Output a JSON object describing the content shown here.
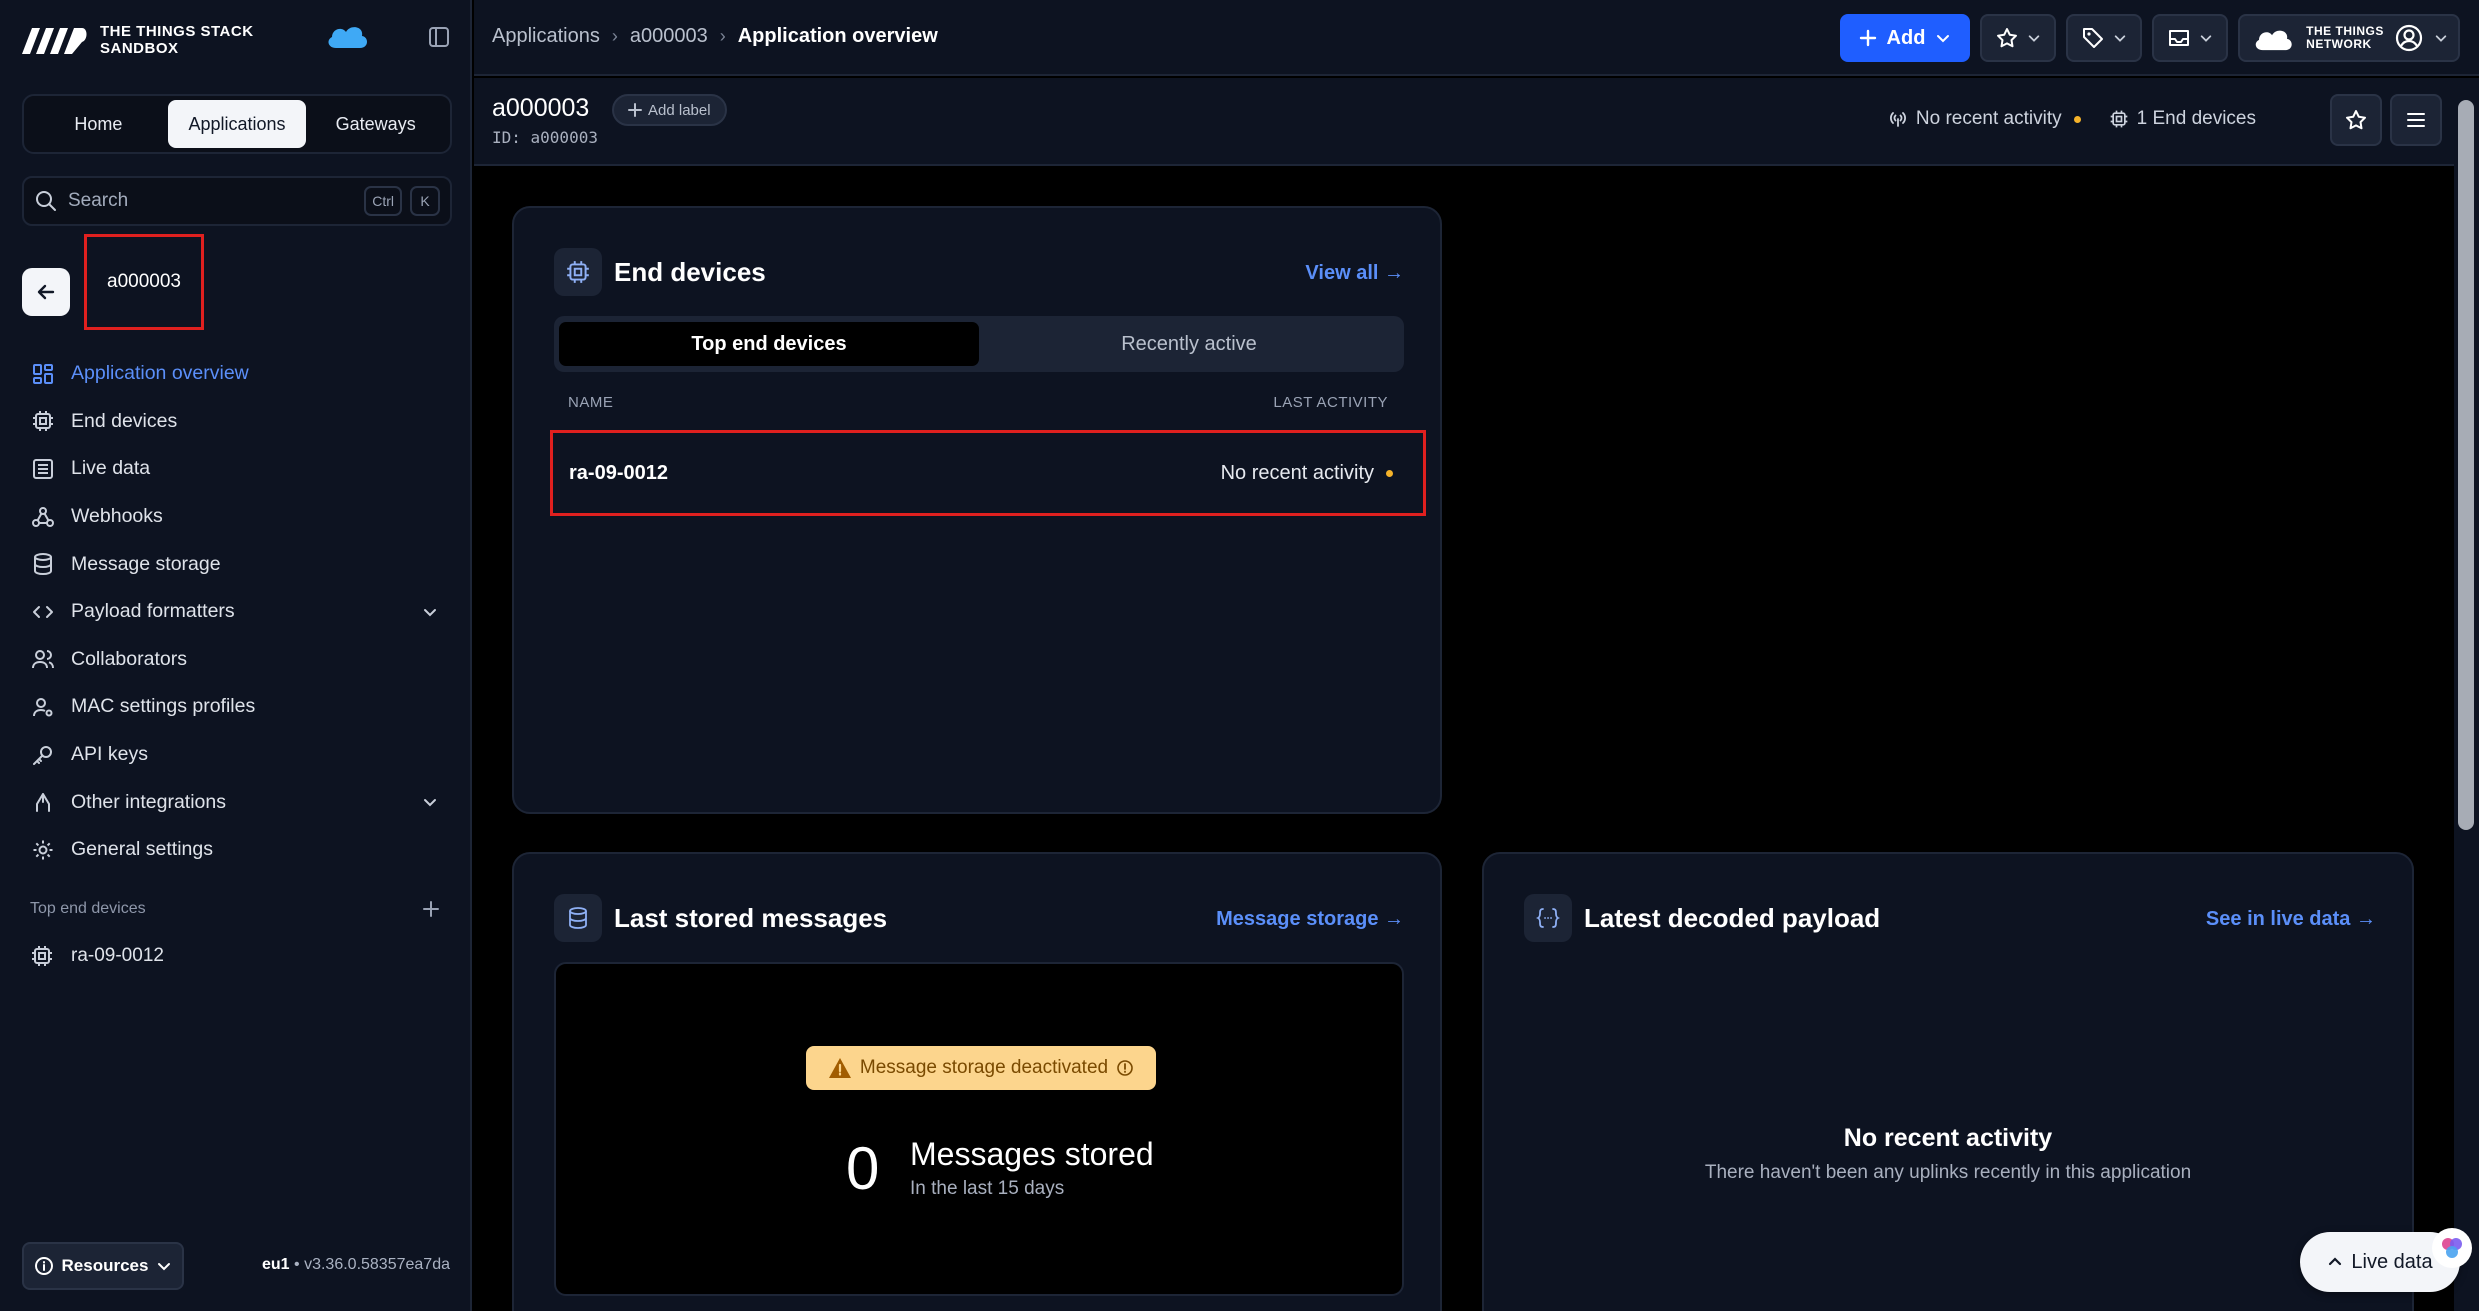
{
  "brand": {
    "logo_line1": "THE THINGS STACK",
    "logo_line2": "SANDBOX",
    "ttn_line1": "THE THINGS",
    "ttn_line2": "NETWORK"
  },
  "sidebar": {
    "segments": [
      "Home",
      "Applications",
      "Gateways"
    ],
    "active_segment": "Applications",
    "search_placeholder": "Search",
    "search_kbd": [
      "Ctrl",
      "K"
    ],
    "app_name": "a000003",
    "nav": [
      {
        "label": "Application overview",
        "icon": "grid-icon",
        "active": true
      },
      {
        "label": "End devices",
        "icon": "chip-icon"
      },
      {
        "label": "Live data",
        "icon": "list-icon"
      },
      {
        "label": "Webhooks",
        "icon": "webhook-icon"
      },
      {
        "label": "Message storage",
        "icon": "database-icon"
      },
      {
        "label": "Payload formatters",
        "icon": "code-icon",
        "expandable": true
      },
      {
        "label": "Collaborators",
        "icon": "users-icon"
      },
      {
        "label": "MAC settings profiles",
        "icon": "user-settings-icon"
      },
      {
        "label": "API keys",
        "icon": "key-icon"
      },
      {
        "label": "Other integrations",
        "icon": "integrations-icon",
        "expandable": true
      },
      {
        "label": "General settings",
        "icon": "gear-icon"
      }
    ],
    "top_devices_heading": "Top end devices",
    "top_devices": [
      "ra-09-0012"
    ],
    "resources_label": "Resources",
    "region": "eu1",
    "version": "v3.36.0.58357ea7da"
  },
  "topbar": {
    "breadcrumb": [
      "Applications",
      "a000003",
      "Application overview"
    ],
    "add_label": "Add"
  },
  "subheader": {
    "title": "a000003",
    "id_text": "ID: a000003",
    "add_label": "Add label",
    "activity": "No recent activity",
    "end_devices": "1 End devices"
  },
  "end_devices_card": {
    "title": "End devices",
    "link": "View all →",
    "tabs": [
      "Top end devices",
      "Recently active"
    ],
    "col_name": "NAME",
    "col_activity": "LAST ACTIVITY",
    "rows": [
      {
        "name": "ra-09-0012",
        "activity": "No recent activity"
      }
    ]
  },
  "messages_card": {
    "title": "Last stored messages",
    "link": "Message storage →",
    "warning": "Message storage deactivated",
    "count": "0",
    "count_label": "Messages stored",
    "count_sub": "In the last 15 days"
  },
  "payload_card": {
    "title": "Latest decoded payload",
    "link": "See in live data →",
    "empty_title": "No recent activity",
    "empty_sub": "There haven't been any uplinks recently in this application"
  },
  "floating": {
    "live_data": "Live data"
  },
  "colors": {
    "accent": "#5b8ff9",
    "primary_button": "#1f5eff",
    "highlight_border": "#e0201f",
    "status_dot": "#f5b32a",
    "warning_bg": "#fcd58d"
  }
}
